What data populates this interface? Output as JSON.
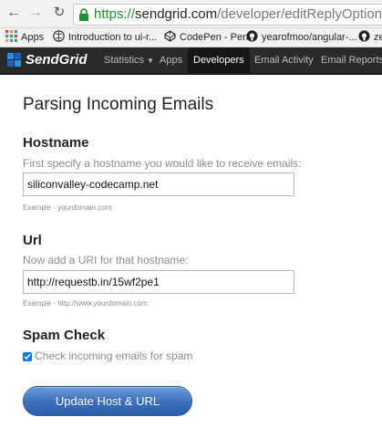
{
  "browser": {
    "url": {
      "scheme": "https://",
      "host": "sendgrid.com",
      "path": "/developer/editReplyOption/reply_i"
    },
    "bookmarks": [
      {
        "label": "Apps",
        "icon": "apps-grid-icon"
      },
      {
        "label": "Introduction to ui-r...",
        "icon": "globe-icon"
      },
      {
        "label": "CodePen - Pen",
        "icon": "codepen-icon"
      },
      {
        "label": "yearofmoo/angular-...",
        "icon": "github-icon"
      },
      {
        "label": "ze",
        "icon": "github-icon"
      }
    ]
  },
  "sendgrid_nav": {
    "logo": "SendGrid",
    "items": [
      {
        "label": "Statistics",
        "has_caret": true,
        "active": false
      },
      {
        "label": "Apps",
        "active": false
      },
      {
        "label": "Developers",
        "active": true
      },
      {
        "label": "Email Activity",
        "active": false
      },
      {
        "label": "Email Reports",
        "active": false
      }
    ]
  },
  "page": {
    "title": "Parsing Incoming Emails",
    "hostname": {
      "heading": "Hostname",
      "help": "First specify a hostname you would like to receive emails:",
      "value": "siliconvalley-codecamp.net",
      "example": "Example - yourdomain.com"
    },
    "url": {
      "heading": "Url",
      "help": "Now add a URI for that hostname:",
      "value": "http://requestb.in/15wf2pe1",
      "example": "Example - http://www.yourdomain.com"
    },
    "spam": {
      "heading": "Spam Check",
      "checkbox_label": "Check incoming emails for spam",
      "checked": true
    },
    "submit_label": "Update Host & URL"
  },
  "colors": {
    "nav_bg": "#2a2a2a",
    "button_blue": "#3a6fbd",
    "https_green": "#1e8f2e",
    "muted_text": "#8b8b8b"
  }
}
